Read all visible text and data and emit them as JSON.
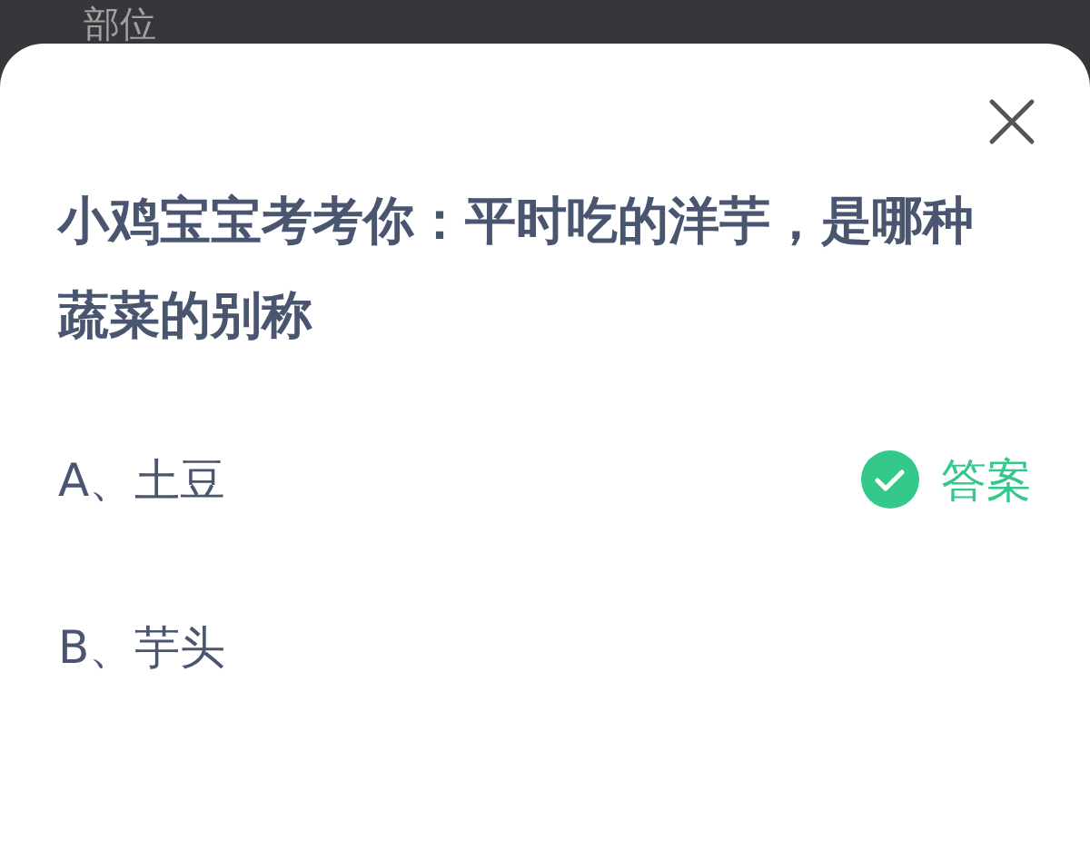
{
  "background": {
    "title": "部位"
  },
  "sheet": {
    "question": "小鸡宝宝考考你：平时吃的洋芋，是哪种蔬菜的别称",
    "options": [
      {
        "label": "A、土豆",
        "correct": true,
        "answer_label": "答案"
      },
      {
        "label": "B、芋头",
        "correct": false
      }
    ]
  }
}
